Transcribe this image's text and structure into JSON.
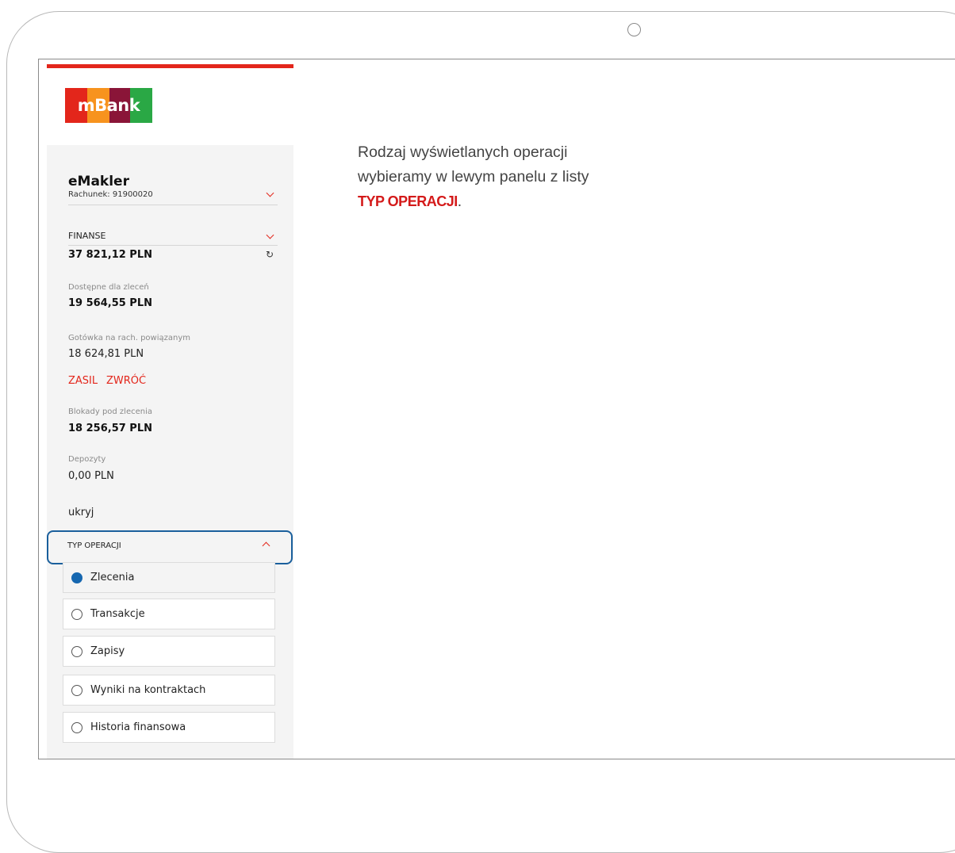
{
  "brand": {
    "logo_text": "mBank",
    "stripe_colors": [
      "#e3261b",
      "#f7931e",
      "#8a1538",
      "#2aa845"
    ]
  },
  "account": {
    "name": "eMakler",
    "number_label": "Rachunek: 91900020"
  },
  "finance": {
    "section_label": "FINANSE",
    "total": "37 821,12 PLN",
    "refresh_icon": "refresh-icon",
    "available_label": "Dostępne dla zleceń",
    "available_value": "19 564,55 PLN",
    "cash_label": "Gotówka na rach. powiązanym",
    "cash_value": "18 624,81 PLN",
    "topup_link": "ZASIL",
    "return_link": "ZWRÓĆ",
    "blocked_label": "Blokady pod zlecenia",
    "blocked_value": "18 256,57 PLN",
    "deposits_label": "Depozyty",
    "deposits_value": "0,00 PLN",
    "hide_link": "ukryj"
  },
  "operation_type": {
    "label": "TYP OPERACJI",
    "options": [
      {
        "label": "Zlecenia",
        "selected": true
      },
      {
        "label": "Transakcje",
        "selected": false
      },
      {
        "label": "Zapisy",
        "selected": false
      },
      {
        "label": "Wyniki na kontraktach",
        "selected": false
      },
      {
        "label": "Historia finansowa",
        "selected": false
      }
    ]
  },
  "info": {
    "line1": "Rodzaj wyświetlanych operacji",
    "line2": "wybieramy w lewym panelu z listy",
    "highlight": "TYP OPERACJI",
    "suffix": "."
  },
  "colors": {
    "accent_red": "#e3261b",
    "highlight_blue": "#1a5f9c",
    "radio_selected": "#1667b0"
  }
}
